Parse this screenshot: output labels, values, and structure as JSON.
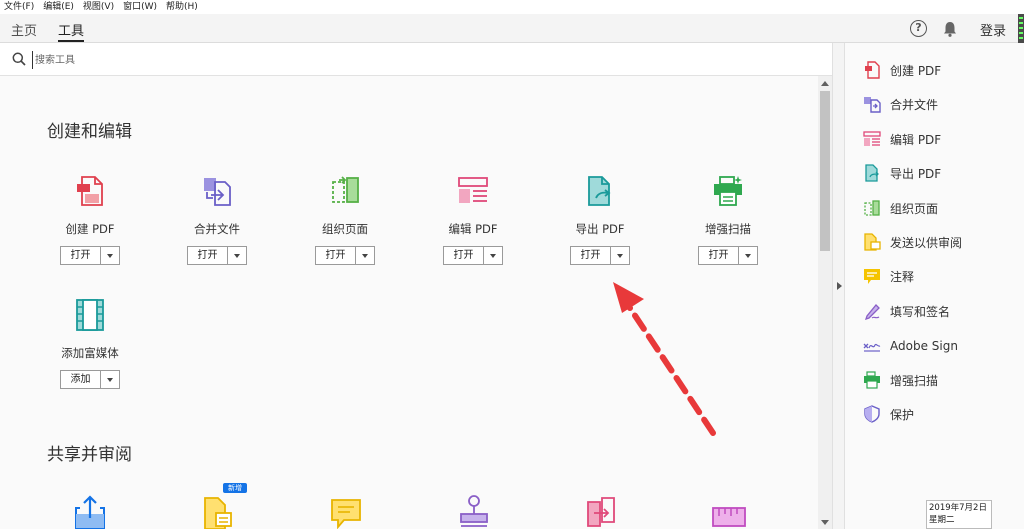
{
  "menubar": [
    "文件(F)",
    "编辑(E)",
    "视图(V)",
    "窗口(W)",
    "帮助(H)"
  ],
  "tabs": [
    {
      "label": "主页"
    },
    {
      "label": "工具",
      "active": true
    }
  ],
  "header": {
    "login": "登录",
    "help_icon": "help-icon",
    "bell_icon": "bell-icon"
  },
  "search": {
    "placeholder": "搜索工具"
  },
  "sections": [
    {
      "title": "创建和编辑",
      "tools": [
        {
          "label": "创建 PDF",
          "button": "打开",
          "icon": "create-pdf-icon",
          "color": "#e0404e"
        },
        {
          "label": "合并文件",
          "button": "打开",
          "icon": "combine-files-icon",
          "color": "#6a5fc7"
        },
        {
          "label": "组织页面",
          "button": "打开",
          "icon": "organize-pages-icon",
          "color": "#55b046"
        },
        {
          "label": "编辑 PDF",
          "button": "打开",
          "icon": "edit-pdf-icon",
          "color": "#e0497a"
        },
        {
          "label": "导出 PDF",
          "button": "打开",
          "icon": "export-pdf-icon",
          "color": "#1a9a9a"
        },
        {
          "label": "增强扫描",
          "button": "打开",
          "icon": "enhance-scan-icon",
          "color": "#2fa84f"
        },
        {
          "label": "添加富媒体",
          "button": "添加",
          "icon": "rich-media-icon",
          "color": "#1a9a9a"
        }
      ]
    },
    {
      "title": "共享并审阅",
      "badge": "新增",
      "tools": [
        {
          "icon": "share-icon",
          "color": "#1473e6"
        },
        {
          "icon": "send-for-review-icon",
          "color": "#e8b400"
        },
        {
          "icon": "comment-icon",
          "color": "#e8b400"
        },
        {
          "icon": "stamp-icon",
          "color": "#8a5fc7"
        },
        {
          "icon": "compare-icon",
          "color": "#e0497a"
        },
        {
          "icon": "measure-icon",
          "color": "#c04cc0"
        }
      ]
    }
  ],
  "rightpanel": [
    {
      "label": "创建 PDF",
      "icon": "create-pdf-icon",
      "color": "#e0404e"
    },
    {
      "label": "合并文件",
      "icon": "combine-files-icon",
      "color": "#6a5fc7"
    },
    {
      "label": "编辑 PDF",
      "icon": "edit-pdf-icon",
      "color": "#e0497a"
    },
    {
      "label": "导出 PDF",
      "icon": "export-pdf-icon",
      "color": "#1a9a9a"
    },
    {
      "label": "组织页面",
      "icon": "organize-pages-icon",
      "color": "#55b046"
    },
    {
      "label": "发送以供审阅",
      "icon": "send-for-review-icon",
      "color": "#e8b400"
    },
    {
      "label": "注释",
      "icon": "comment-icon",
      "color": "#e8b400"
    },
    {
      "label": "填写和签名",
      "icon": "fill-sign-icon",
      "color": "#8a5fc7"
    },
    {
      "label": "Adobe Sign",
      "icon": "adobe-sign-icon",
      "color": "#6a5fc7"
    },
    {
      "label": "增强扫描",
      "icon": "enhance-scan-icon",
      "color": "#2fa84f"
    },
    {
      "label": "保护",
      "icon": "protect-icon",
      "color": "#6a5fc7"
    }
  ],
  "taskbar": {
    "date": "2019年7月2日",
    "weekday": "星期二"
  },
  "colors": {
    "annotation_arrow": "#e8393a",
    "accent": "#1473e6"
  }
}
